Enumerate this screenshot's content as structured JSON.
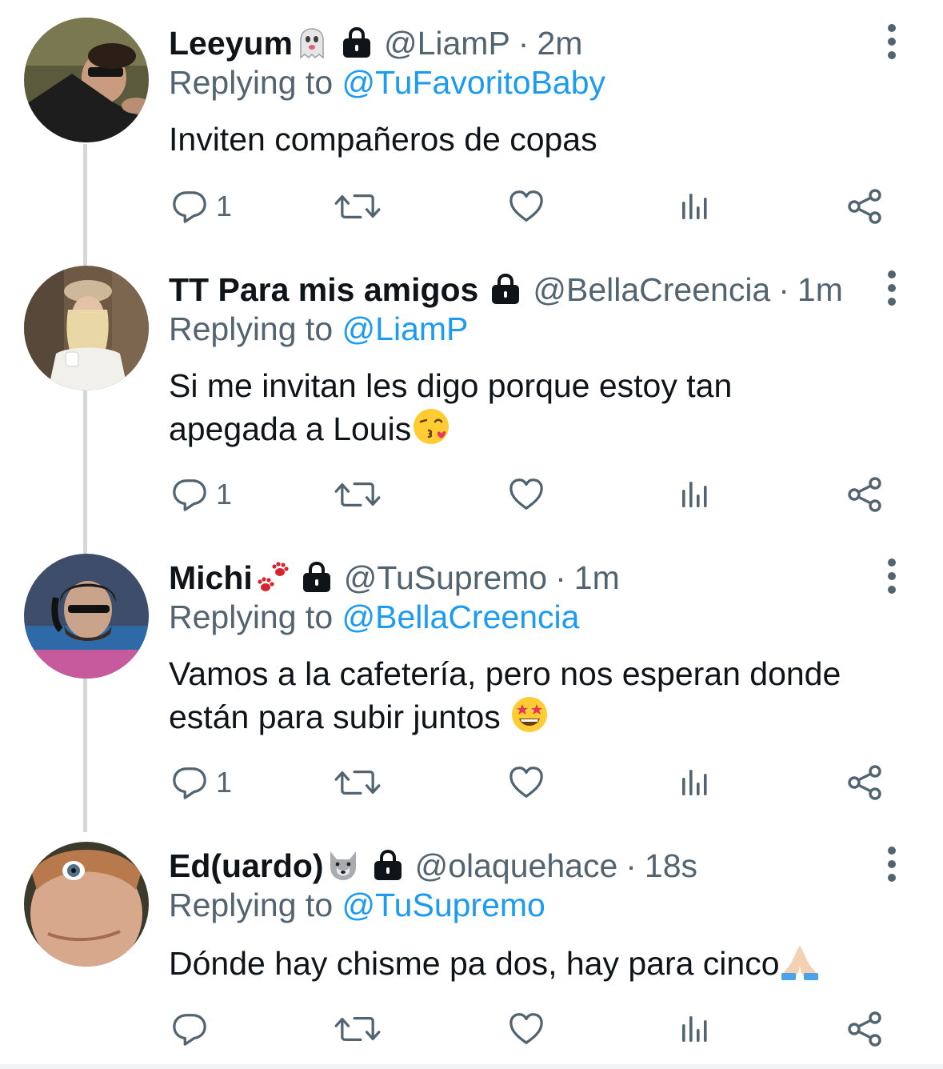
{
  "colors": {
    "text": "#0f1419",
    "secondary": "#536471",
    "link": "#1d9bf0",
    "thread_line": "#d5d9dd"
  },
  "replying_label": "Replying to",
  "tweets": [
    {
      "display_name": "Leeyum",
      "name_emoji": "ghost",
      "handle": "@LiamP",
      "dot": "·",
      "time": "2m",
      "reply_to": "@TuFavoritoBaby",
      "text": "Inviten compañeros de copas",
      "reply_count": "1"
    },
    {
      "display_name": "TT Para mis amigos",
      "name_emoji": "",
      "handle": "@BellaCreencia",
      "dot": "·",
      "time": "1m",
      "reply_to": "@LiamP",
      "text_line1": "Si me invitan les digo porque estoy tan",
      "text_line2": "apegada a Louis",
      "text_emoji": "face-blowing-kiss",
      "reply_count": "1"
    },
    {
      "display_name": "Michi",
      "name_emoji": "paw-prints",
      "handle": "@TuSupremo",
      "dot": "·",
      "time": "1m",
      "reply_to": "@BellaCreencia",
      "text_line1": "Vamos a la cafetería, pero nos esperan donde",
      "text_line2": "están para subir juntos",
      "text_emoji": "star-struck",
      "reply_count": "1"
    },
    {
      "display_name": "Ed(uardo)",
      "name_emoji": "wolf",
      "handle": "@olaquehace",
      "dot": "·",
      "time": "18s",
      "reply_to": "@TuSupremo",
      "text": "Dónde hay chisme pa dos, hay para cinco",
      "text_emoji": "folded-hands",
      "reply_count": ""
    }
  ],
  "icons": {
    "reply": "reply-bubble-icon",
    "retweet": "retweet-icon",
    "like": "heart-icon",
    "views": "views-bar-chart-icon",
    "share": "share-icon",
    "lock": "lock-icon",
    "more": "more-vertical-icon"
  }
}
